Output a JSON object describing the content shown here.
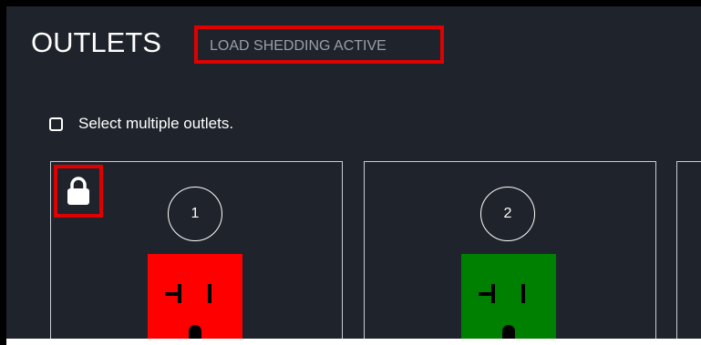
{
  "header": {
    "title": "OUTLETS",
    "status": "LOAD SHEDDING ACTIVE"
  },
  "select_multiple": {
    "label": "Select multiple outlets.",
    "checked": false
  },
  "outlets": [
    {
      "number": "1",
      "state_color": "#ff0000",
      "locked": true,
      "lock_icon": "lock-icon"
    },
    {
      "number": "2",
      "state_color": "#008000",
      "locked": false
    }
  ],
  "colors": {
    "panel_background": "#1f232b",
    "highlight_border": "#e00000",
    "status_text": "#9aa0a8",
    "outlet_off": "#ff0000",
    "outlet_on": "#008000"
  }
}
